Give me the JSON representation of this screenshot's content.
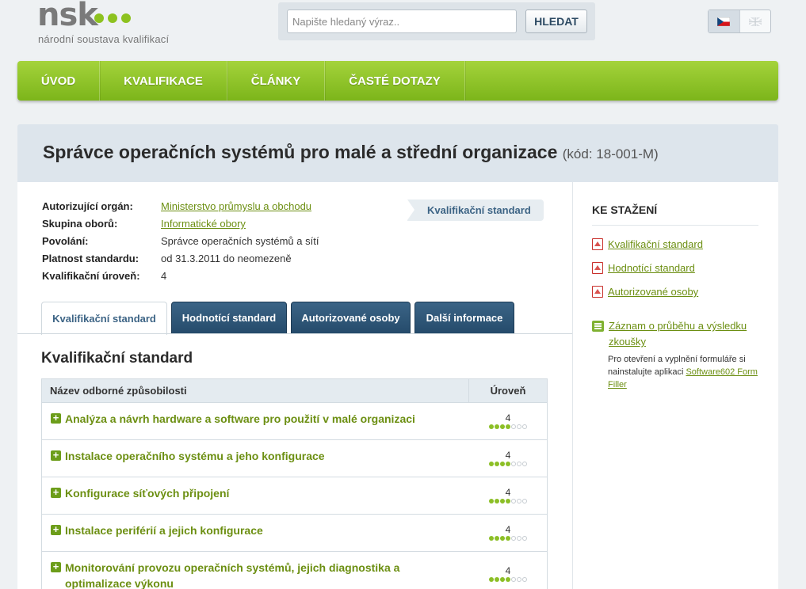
{
  "logo": {
    "text": "nsk",
    "subtitle": "národní soustava kvalifikací"
  },
  "search": {
    "placeholder": "Napište hledaný výraz..",
    "button": "HLEDAT"
  },
  "language": {
    "active": "cs",
    "icons": [
      "czech-flag-icon",
      "uk-flag-icon"
    ]
  },
  "nav": {
    "items": [
      "ÚVOD",
      "KVALIFIKACE",
      "ČLÁNKY",
      "ČASTÉ DOTAZY"
    ]
  },
  "title": {
    "main": "Správce operačních systémů pro malé a střední organizace",
    "code": "(kód: 18-001-M)"
  },
  "meta": {
    "rows": [
      {
        "label": "Autorizující orgán:",
        "value": "Ministerstvo průmyslu a obchodu"
      },
      {
        "label": "Skupina oborů:",
        "value": "Informatické obory"
      },
      {
        "label": "Povolání:",
        "value": "Správce operačních systémů a sítí"
      },
      {
        "label": "Platnost standardu:",
        "value": "od 31.3.2011 do neomezeně"
      },
      {
        "label": "Kvalifikační úroveň:",
        "value": "4"
      }
    ]
  },
  "badge": "Kvalifikační standard",
  "tabs": [
    "Kvalifikační standard",
    "Hodnotící standard",
    "Autorizované osoby",
    "Další informace"
  ],
  "section": {
    "title": "Kvalifikační standard",
    "col_name": "Název odborné způsobilosti",
    "col_level": "Úroveň",
    "rows": [
      {
        "name": "Analýza a návrh hardware a software pro použití v malé organizaci",
        "level": "4",
        "filled": 4,
        "total": 7
      },
      {
        "name": "Instalace operačního systému a jeho konfigurace",
        "level": "4",
        "filled": 4,
        "total": 7
      },
      {
        "name": "Konfigurace síťových připojení",
        "level": "4",
        "filled": 4,
        "total": 7
      },
      {
        "name": "Instalace periférií a jejich konfigurace",
        "level": "4",
        "filled": 4,
        "total": 7
      },
      {
        "name": "Monitorování provozu operačních systémů, jejich diagnostika a optimalizace výkonu",
        "level": "4",
        "filled": 4,
        "total": 7
      }
    ]
  },
  "side": {
    "title": "KE STAŽENÍ",
    "downloads": [
      "Kvalifikační standard",
      "Hodnotící standard",
      "Autorizované osoby"
    ],
    "record_link": "Záznam o průběhu a výsledku zkoušky",
    "note_text": "Pro otevření a vyplnění formuláře si nainstalujte aplikaci",
    "note_link": "Software602 Form Filler"
  }
}
